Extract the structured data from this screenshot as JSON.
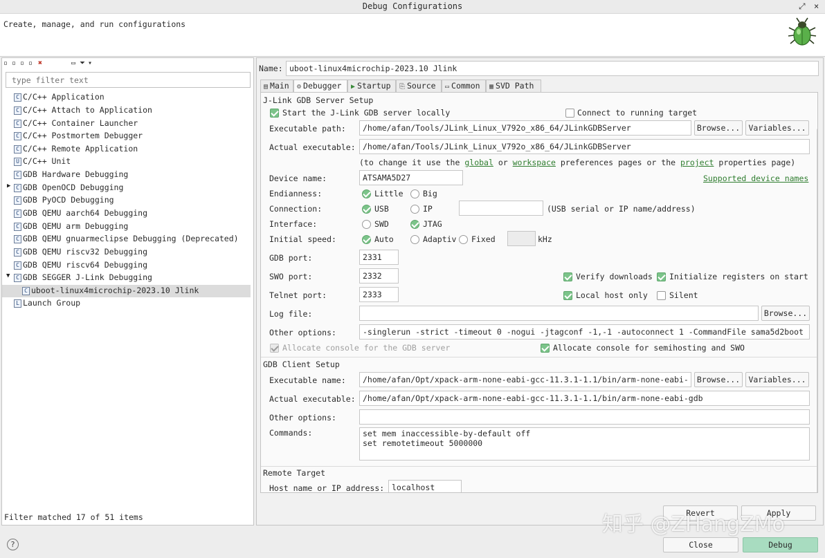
{
  "window": {
    "title": "Debug Configurations",
    "pin_icon": "expand-icon",
    "close_label": "×"
  },
  "header": {
    "message": "Create, manage, and run configurations"
  },
  "left": {
    "filter_placeholder": "type filter text",
    "items": [
      {
        "label": "C/C++ Application",
        "icon": "C"
      },
      {
        "label": "C/C++ Attach to Application",
        "icon": "C"
      },
      {
        "label": "C/C++ Container Launcher",
        "icon": "C"
      },
      {
        "label": "C/C++ Postmortem Debugger",
        "icon": "C"
      },
      {
        "label": "C/C++ Remote Application",
        "icon": "C"
      },
      {
        "label": "C/C++ Unit",
        "icon": "U"
      },
      {
        "label": "GDB Hardware Debugging",
        "icon": "C"
      },
      {
        "label": "GDB OpenOCD Debugging",
        "icon": "C"
      },
      {
        "label": "GDB PyOCD Debugging",
        "icon": "C"
      },
      {
        "label": "GDB QEMU aarch64 Debugging",
        "icon": "C"
      },
      {
        "label": "GDB QEMU arm Debugging",
        "icon": "C"
      },
      {
        "label": "GDB QEMU gnuarmeclipse Debugging (Deprecated)",
        "icon": "C"
      },
      {
        "label": "GDB QEMU riscv32 Debugging",
        "icon": "C"
      },
      {
        "label": "GDB QEMU riscv64 Debugging",
        "icon": "C"
      },
      {
        "label": "GDB SEGGER J-Link Debugging",
        "icon": "C"
      },
      {
        "label": "uboot-linux4microchip-2023.10 Jlink",
        "icon": "C"
      },
      {
        "label": "Launch Group",
        "icon": "L"
      }
    ],
    "status": "Filter matched 17 of 51 items"
  },
  "config": {
    "name_label": "Name:",
    "name_value": "uboot-linux4microchip-2023.10 Jlink",
    "tabs": [
      "Main",
      "Debugger",
      "Startup",
      "Source",
      "Common",
      "SVD Path"
    ],
    "server": {
      "heading": "J-Link GDB Server Setup",
      "start_local": "Start the J-Link GDB server locally",
      "connect_running": "Connect to running target",
      "exec_path_label": "Executable path:",
      "exec_path": "/home/afan/Tools/JLink_Linux_V792o_x86_64/JLinkGDBServer",
      "browse": "Browse...",
      "variables": "Variables...",
      "actual_exec_label": "Actual executable:",
      "actual_exec": "/home/afan/Tools/JLink_Linux_V792o_x86_64/JLinkGDBServer",
      "hint_a": "(to change it use the",
      "hint_global": "global",
      "hint_or": "or",
      "hint_workspace": "workspace",
      "hint_b": "preferences pages or the",
      "hint_project": "project",
      "hint_c": "properties page)",
      "device_label": "Device name:",
      "device": "ATSAMA5D27",
      "supported_devices": "Supported device names",
      "endianness_label": "Endianness:",
      "little": "Little",
      "big": "Big",
      "connection_label": "Connection:",
      "usb": "USB",
      "ip": "IP",
      "conn_hint": "(USB serial or IP name/address)",
      "interface_label": "Interface:",
      "swd": "SWD",
      "jtag": "JTAG",
      "speed_label": "Initial speed:",
      "auto": "Auto",
      "adaptive": "Adaptiv",
      "fixed": "Fixed",
      "khz": "kHz",
      "gdb_port_label": "GDB port:",
      "gdb_port": "2331",
      "swo_port_label": "SWO port:",
      "swo_port": "2332",
      "verify_downloads": "Verify downloads",
      "init_registers": "Initialize registers on start",
      "telnet_label": "Telnet port:",
      "telnet_port": "2333",
      "local_host_only": "Local host only",
      "silent": "Silent",
      "log_label": "Log file:",
      "other_label": "Other options:",
      "other_options": "-singlerun -strict -timeout 0 -nogui -jtagconf -1,-1 -autoconnect 1 -CommandFile sama5d2boot",
      "alloc_console": "Allocate console for the GDB server",
      "alloc_semihosting": "Allocate console for semihosting and SWO"
    },
    "client": {
      "heading": "GDB Client Setup",
      "exec_name_label": "Executable name:",
      "exec_name": "/home/afan/Opt/xpack-arm-none-eabi-gcc-11.3.1-1.1/bin/arm-none-eabi-",
      "browse": "Browse...",
      "variables": "Variables...",
      "actual_exec_label": "Actual executable:",
      "actual_exec": "/home/afan/Opt/xpack-arm-none-eabi-gcc-11.3.1-1.1/bin/arm-none-eabi-gdb",
      "other_label": "Other options:",
      "commands_label": "Commands:",
      "commands": [
        "set mem inaccessible-by-default off",
        "set remotetimeout 5000000"
      ]
    },
    "remote": {
      "heading": "Remote Target",
      "host_label": "Host name or IP address:",
      "host": "localhost"
    },
    "revert": "Revert",
    "apply": "Apply"
  },
  "footer": {
    "help": "?",
    "close": "Close",
    "debug": "Debug"
  },
  "watermark": "知乎 @ZHangZMo",
  "colors": {
    "accent_green": "#7cc48a",
    "debug_button": "#a8dcc0",
    "link": "#2f7d2f"
  }
}
